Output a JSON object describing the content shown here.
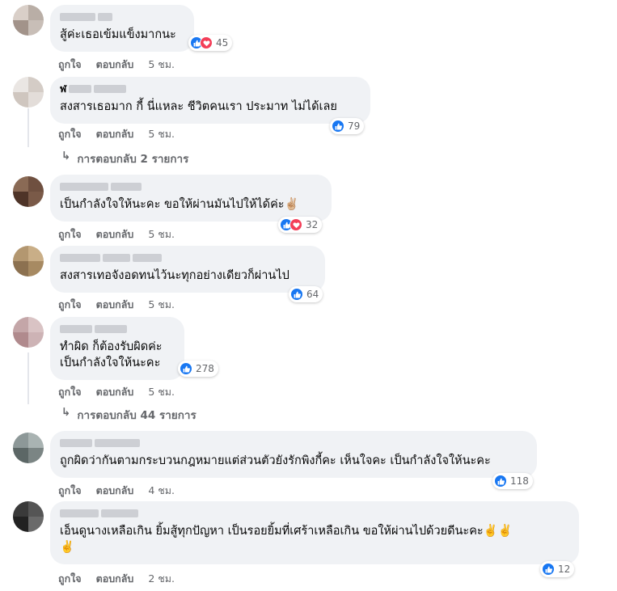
{
  "actions": {
    "like": "ถูกใจ",
    "reply": "ตอบกลับ"
  },
  "replies_icon": "reply-arrow-icon",
  "colors": {
    "like": "#1877f2",
    "love": "#f33e58",
    "bubble": "#f0f2f5",
    "meta": "#65676b"
  },
  "comments": [
    {
      "name_visible": "",
      "text": "สู้ค่ะเธอเข้มแข็งมากนะ",
      "reactions": [
        "like",
        "love"
      ],
      "count": "45",
      "time": "5 ชม."
    },
    {
      "name_visible": "ฬ",
      "text": "สงสารเธอมาก กี้ นี่แหละ ชีวิตคนเรา ประมาท ไม่ได้เลย",
      "reactions": [
        "like"
      ],
      "count": "79",
      "time": "5 ชม.",
      "replies": "การตอบกลับ 2 รายการ"
    },
    {
      "name_visible": "",
      "text": "เป็นกำลังใจให้นะคะ ขอให้ผ่านมันไปให้ได้ค่ะ✌🏼",
      "reactions": [
        "like",
        "love"
      ],
      "count": "32",
      "time": "5 ชม."
    },
    {
      "name_visible": "",
      "text": "สงสารเทอจังอดทนไว้นะทุกอย่างเดียวก็ผ่านไป",
      "reactions": [
        "like"
      ],
      "count": "64",
      "time": "5 ชม."
    },
    {
      "name_visible": "",
      "text": "ทำผิด ก็ต้องรับผิดค่ะ\nเป็นกำลังใจให้นะคะ",
      "reactions": [
        "like"
      ],
      "count": "278",
      "time": "5 ชม.",
      "replies": "การตอบกลับ 44 รายการ"
    },
    {
      "name_visible": "",
      "text": "ถูกผิดว่ากันตามกระบวนกฎหมายแต่ส่วนตัวยังรักพิงกี้คะ เห็นใจคะ เป็นกำลังใจให้นะคะ",
      "reactions": [
        "like"
      ],
      "count": "118",
      "time": "4 ชม."
    },
    {
      "name_visible": "",
      "text": "เอ็นดูนางเหลือเกิน ยิ้มสู้ทุกปัญหา เป็นรอยยิ้มที่เศร้าเหลือเกิน ขอให้ผ่านไปด้วยดีนะคะ✌️✌️\n✌️",
      "reactions": [
        "like"
      ],
      "count": "12",
      "time": "2 ชม."
    }
  ]
}
